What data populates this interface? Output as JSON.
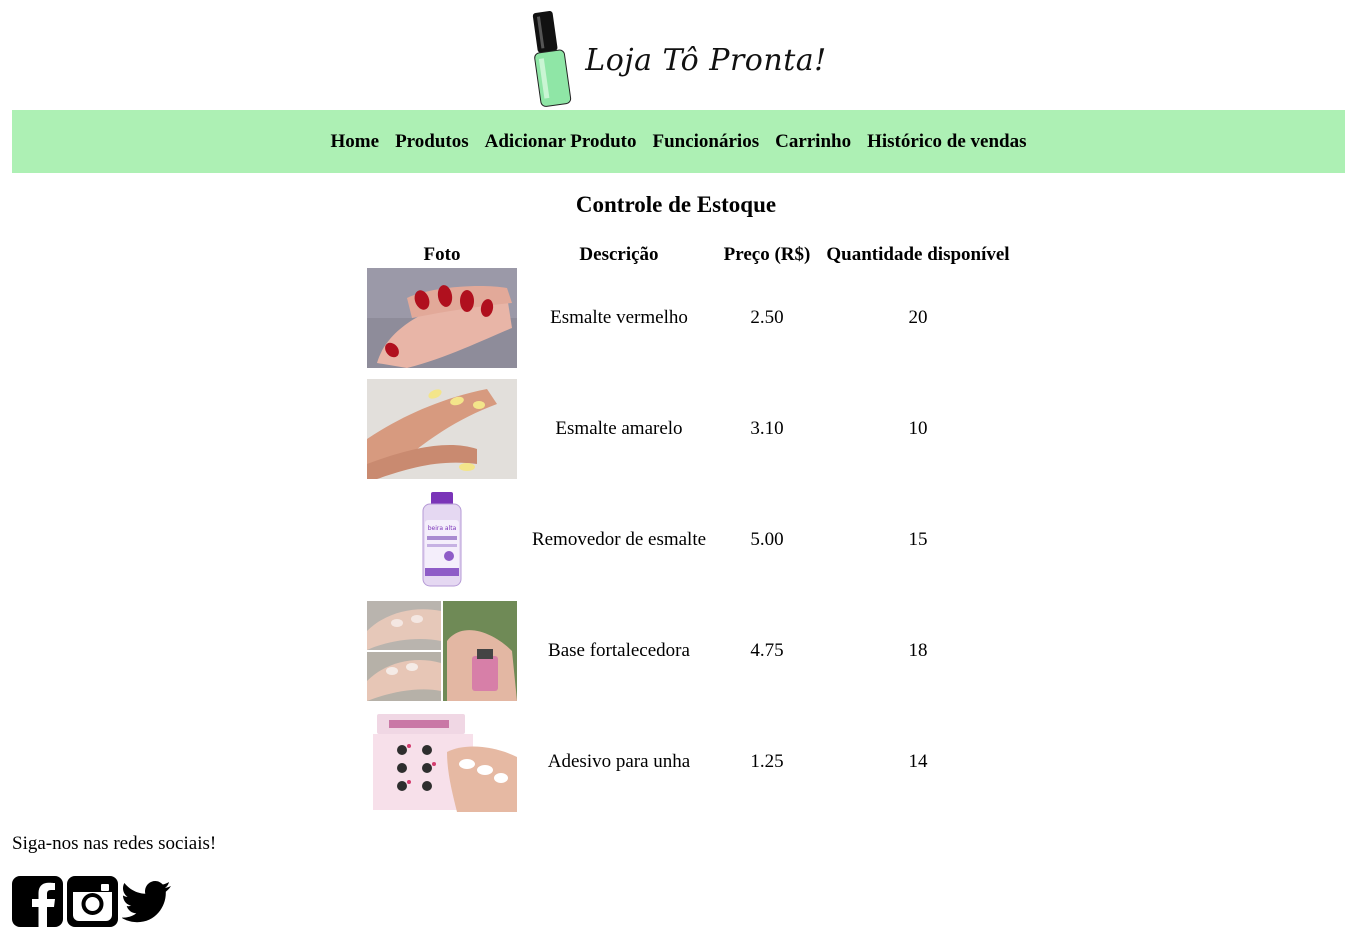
{
  "brand": {
    "name": "Loja Tô Pronta!",
    "bottle_color": "#8fe6a6",
    "nav_color": "#adf0b4"
  },
  "nav": {
    "items": [
      {
        "label": "Home"
      },
      {
        "label": "Produtos"
      },
      {
        "label": "Adicionar Produto"
      },
      {
        "label": "Funcionários"
      },
      {
        "label": "Carrinho"
      },
      {
        "label": "Histórico de vendas"
      }
    ]
  },
  "page": {
    "title": "Controle de Estoque"
  },
  "table": {
    "headers": {
      "photo": "Foto",
      "description": "Descrição",
      "price": "Preço (R$)",
      "quantity": "Quantidade disponível"
    },
    "rows": [
      {
        "image": "red-nail-polish-photo",
        "description": "Esmalte vermelho",
        "price": "2.50",
        "quantity": "20"
      },
      {
        "image": "yellow-nail-polish-photo",
        "description": "Esmalte amarelo",
        "price": "3.10",
        "quantity": "10"
      },
      {
        "image": "nail-polish-remover-bottle-photo",
        "description": "Removedor de esmalte",
        "price": "5.00",
        "quantity": "15"
      },
      {
        "image": "strengthening-base-collage-photo",
        "description": "Base fortalecedora",
        "price": "4.75",
        "quantity": "18"
      },
      {
        "image": "nail-sticker-photo",
        "description": "Adesivo para unha",
        "price": "1.25",
        "quantity": "14"
      }
    ]
  },
  "footer": {
    "social_text": "Siga-nos nas redes sociais!",
    "icons": [
      "facebook-icon",
      "instagram-icon",
      "twitter-icon"
    ]
  }
}
